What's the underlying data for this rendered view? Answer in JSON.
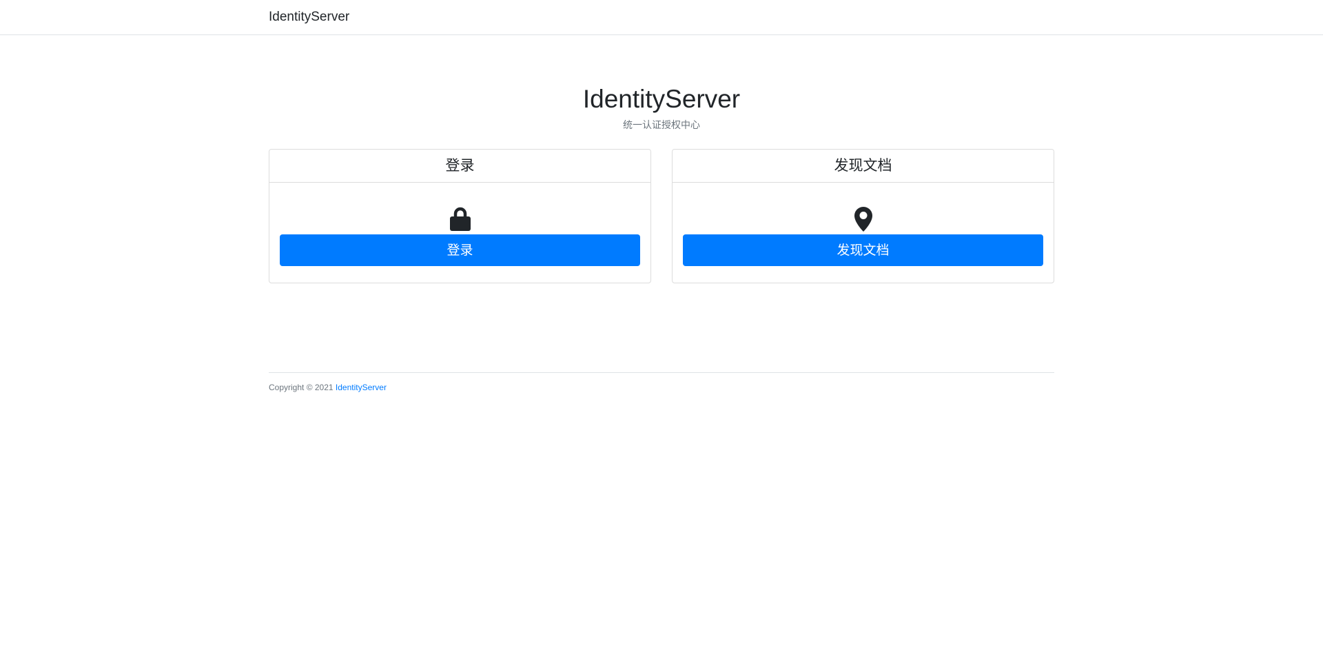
{
  "navbar": {
    "brand": "IdentityServer"
  },
  "hero": {
    "title": "IdentityServer",
    "subtitle": "统一认证授权中心"
  },
  "cards": [
    {
      "header": "登录",
      "icon": "lock-icon",
      "button_label": "登录"
    },
    {
      "header": "发现文档",
      "icon": "map-marker-icon",
      "button_label": "发现文档"
    }
  ],
  "footer": {
    "copyright": "Copyright © 2021",
    "link_text": "IdentityServer"
  },
  "colors": {
    "primary": "#007bff",
    "text": "#212529",
    "muted": "#6c757d",
    "border": "#dee2e6"
  }
}
